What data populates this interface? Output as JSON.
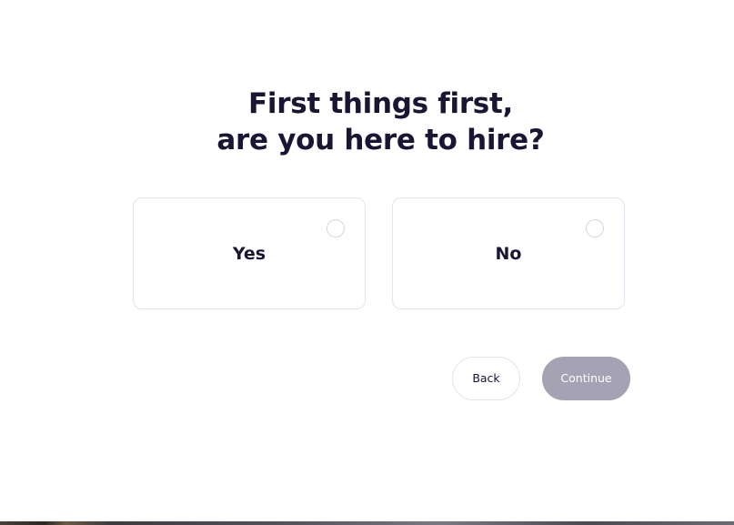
{
  "heading": {
    "line1": "First things first,",
    "line2": "are you here to hire?"
  },
  "options": [
    {
      "label": "Yes",
      "selected": false
    },
    {
      "label": "No",
      "selected": false
    }
  ],
  "buttons": {
    "back_label": "Back",
    "continue_label": "Continue",
    "continue_disabled": true
  },
  "colors": {
    "text": "#1b1433",
    "card_border": "#e4e2ec",
    "continue_disabled_bg": "#a5a3b3"
  }
}
